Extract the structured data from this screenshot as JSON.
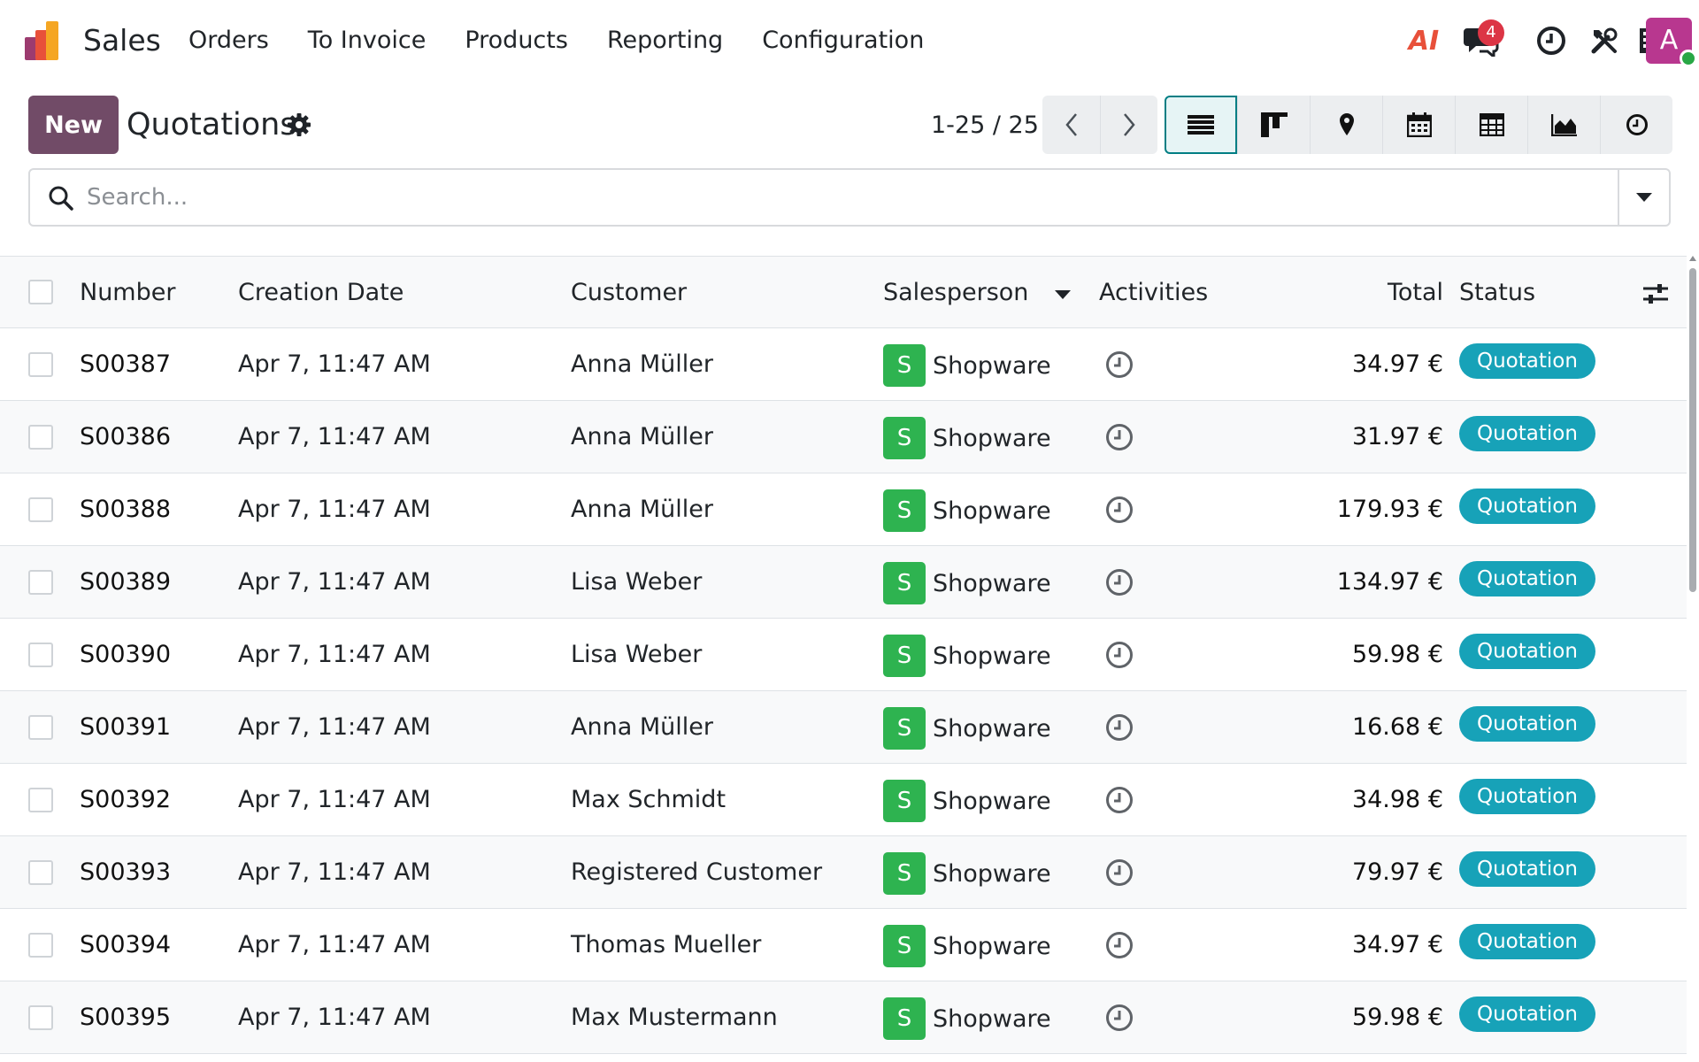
{
  "navbar": {
    "app_name": "Sales",
    "menu": [
      "Orders",
      "To Invoice",
      "Products",
      "Reporting",
      "Configuration"
    ],
    "messages_count": "4",
    "ai_label": "AI",
    "avatar_letter": "A"
  },
  "control": {
    "new_label": "New",
    "title": "Quotations",
    "pager": "1-25 / 25"
  },
  "search": {
    "placeholder": "Search..."
  },
  "table": {
    "columns": {
      "number": "Number",
      "creation_date": "Creation Date",
      "customer": "Customer",
      "salesperson": "Salesperson",
      "activities": "Activities",
      "total": "Total",
      "status": "Status"
    },
    "rows": [
      {
        "number": "S00387",
        "date": "Apr 7, 11:47 AM",
        "customer": "Anna Müller",
        "sp_initial": "S",
        "salesperson": "Shopware",
        "total": "34.97 €",
        "status": "Quotation"
      },
      {
        "number": "S00386",
        "date": "Apr 7, 11:47 AM",
        "customer": "Anna Müller",
        "sp_initial": "S",
        "salesperson": "Shopware",
        "total": "31.97 €",
        "status": "Quotation"
      },
      {
        "number": "S00388",
        "date": "Apr 7, 11:47 AM",
        "customer": "Anna Müller",
        "sp_initial": "S",
        "salesperson": "Shopware",
        "total": "179.93 €",
        "status": "Quotation"
      },
      {
        "number": "S00389",
        "date": "Apr 7, 11:47 AM",
        "customer": "Lisa Weber",
        "sp_initial": "S",
        "salesperson": "Shopware",
        "total": "134.97 €",
        "status": "Quotation"
      },
      {
        "number": "S00390",
        "date": "Apr 7, 11:47 AM",
        "customer": "Lisa Weber",
        "sp_initial": "S",
        "salesperson": "Shopware",
        "total": "59.98 €",
        "status": "Quotation"
      },
      {
        "number": "S00391",
        "date": "Apr 7, 11:47 AM",
        "customer": "Anna Müller",
        "sp_initial": "S",
        "salesperson": "Shopware",
        "total": "16.68 €",
        "status": "Quotation"
      },
      {
        "number": "S00392",
        "date": "Apr 7, 11:47 AM",
        "customer": "Max Schmidt",
        "sp_initial": "S",
        "salesperson": "Shopware",
        "total": "34.98 €",
        "status": "Quotation"
      },
      {
        "number": "S00393",
        "date": "Apr 7, 11:47 AM",
        "customer": "Registered Customer",
        "sp_initial": "S",
        "salesperson": "Shopware",
        "total": "79.97 €",
        "status": "Quotation"
      },
      {
        "number": "S00394",
        "date": "Apr 7, 11:47 AM",
        "customer": "Thomas Mueller",
        "sp_initial": "S",
        "salesperson": "Shopware",
        "total": "34.97 €",
        "status": "Quotation"
      },
      {
        "number": "S00395",
        "date": "Apr 7, 11:47 AM",
        "customer": "Max Mustermann",
        "sp_initial": "S",
        "salesperson": "Shopware",
        "total": "59.98 €",
        "status": "Quotation"
      }
    ]
  },
  "icons": {
    "app_logo": "sales-logo-icon",
    "messages": "chat-icon",
    "activity": "clock-icon",
    "tools": "tools-icon",
    "company": "building-icon",
    "settings": "gear-icon",
    "search": "search-icon",
    "toggle": "caret-down-icon",
    "optional_columns": "sliders-icon"
  },
  "colors": {
    "primary": "#714b67",
    "accent": "#017e84",
    "status_badge": "#17a2b8",
    "salesperson_avatar": "#2eb350",
    "user_avatar": "#b8378f",
    "notification": "#dc3545"
  }
}
